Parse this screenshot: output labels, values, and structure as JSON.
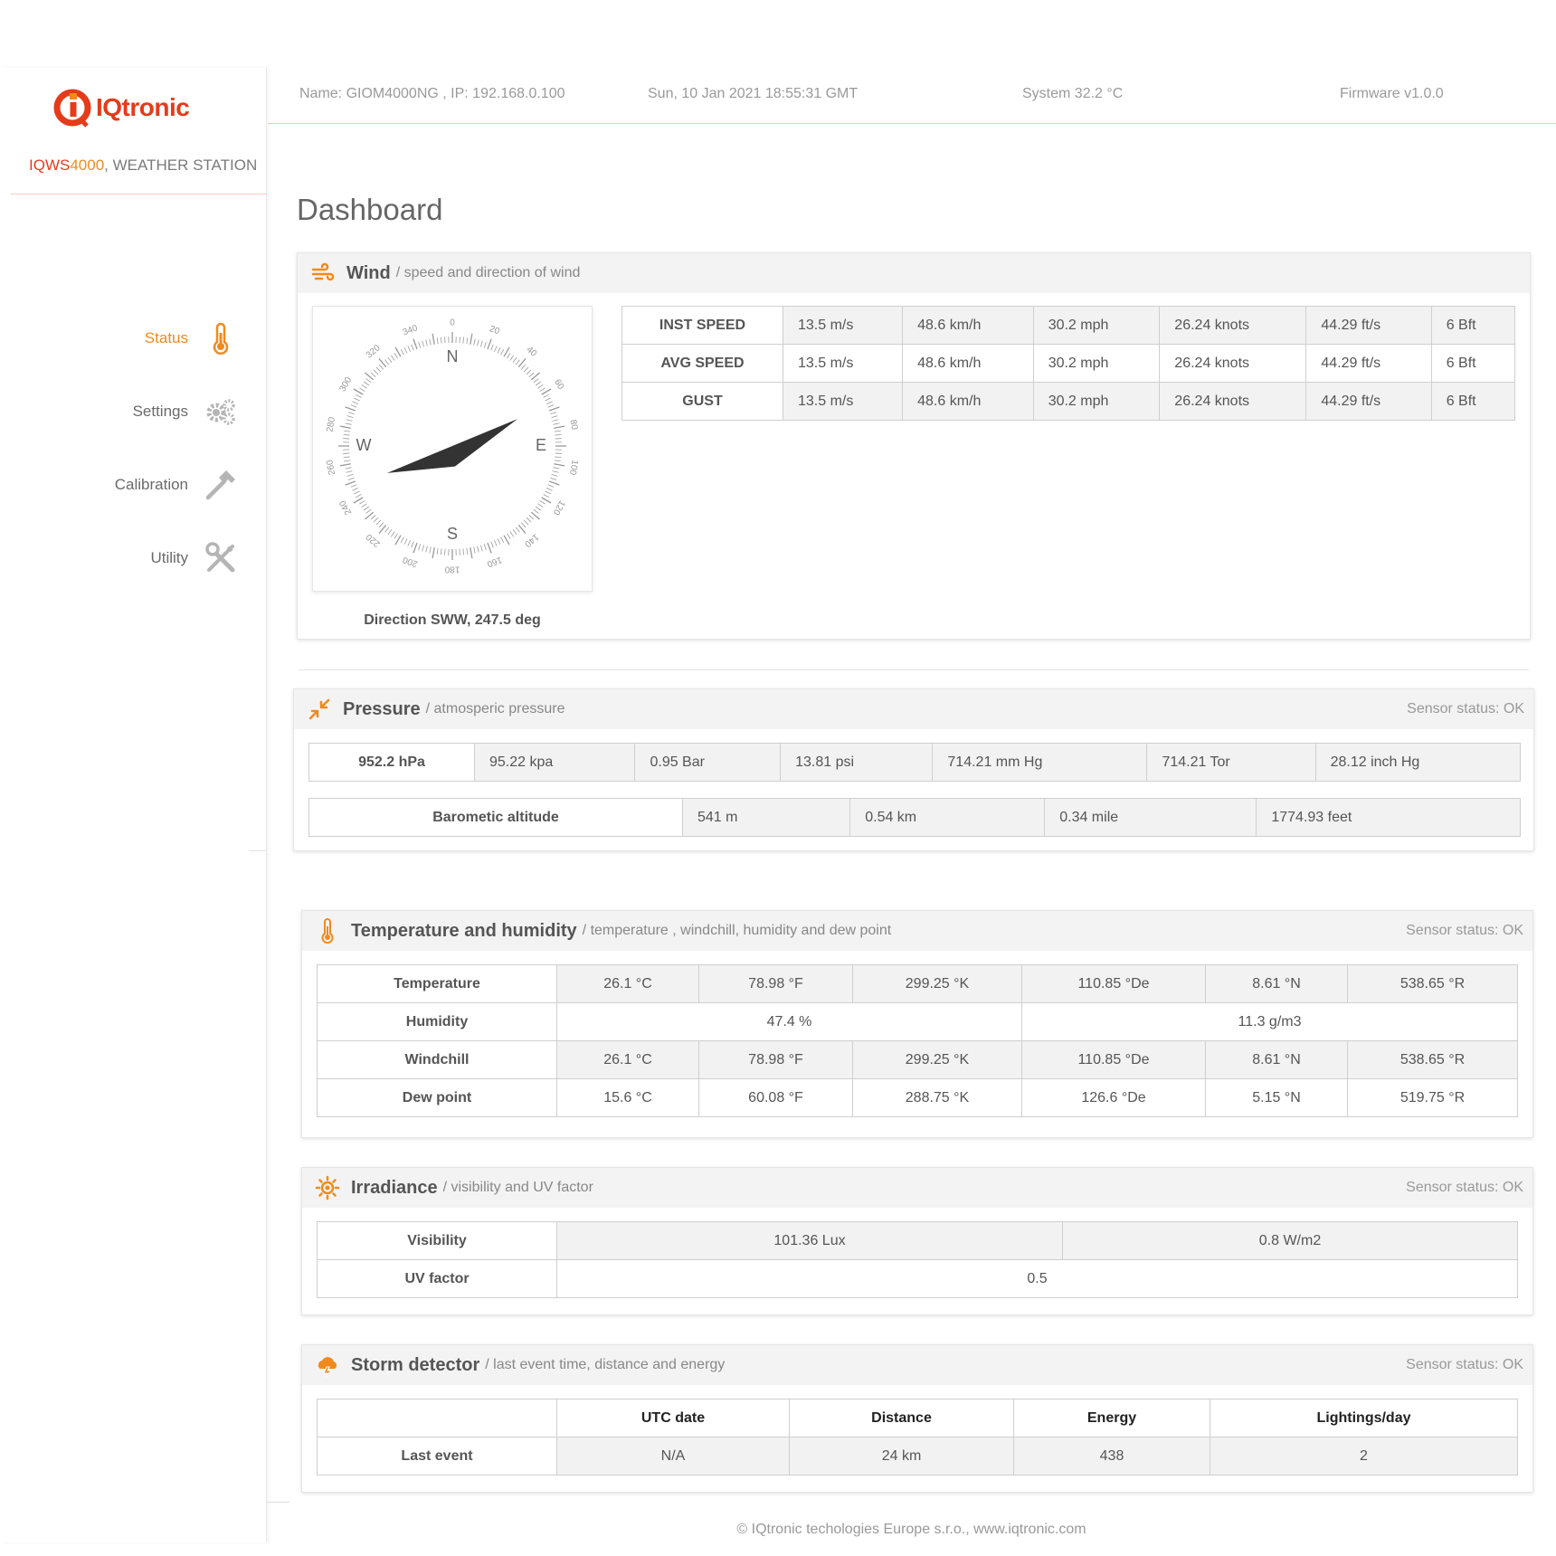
{
  "brand": {
    "logo_text": "IQtronic",
    "model_part1": "IQWS",
    "model_part2": "4000",
    "model_suffix": ", WEATHER STATION"
  },
  "nav": [
    {
      "label": "Status",
      "icon": "thermometer-icon",
      "active": true
    },
    {
      "label": "Settings",
      "icon": "gears-icon",
      "active": false
    },
    {
      "label": "Calibration",
      "icon": "hammer-icon",
      "active": false
    },
    {
      "label": "Utility",
      "icon": "tools-icon",
      "active": false
    }
  ],
  "header": {
    "device": "Name: GIOM4000NG , IP: 192.168.0.100",
    "datetime": "Sun, 10 Jan 2021 18:55:31 GMT",
    "system": "System 32.2 °C",
    "firmware": "Firmware v1.0.0"
  },
  "page_title": "Dashboard",
  "wind": {
    "title": "Wind",
    "subtitle": "/ speed and direction of wind",
    "direction_label": "Direction SWW, 247.5 deg",
    "direction_deg": 247.5,
    "compass": {
      "cardinals": [
        "N",
        "E",
        "S",
        "W"
      ],
      "degrees": [
        "0",
        "20",
        "40",
        "60",
        "80",
        "100",
        "120",
        "140",
        "160",
        "180",
        "200",
        "220",
        "240",
        "260",
        "280",
        "300",
        "320",
        "340"
      ]
    },
    "rows": [
      {
        "label": "INST SPEED",
        "values": [
          "13.5 m/s",
          "48.6 km/h",
          "30.2 mph",
          "26.24 knots",
          "44.29 ft/s",
          "6 Bft"
        ]
      },
      {
        "label": "AVG SPEED",
        "values": [
          "13.5 m/s",
          "48.6 km/h",
          "30.2 mph",
          "26.24 knots",
          "44.29 ft/s",
          "6 Bft"
        ]
      },
      {
        "label": "GUST",
        "values": [
          "13.5 m/s",
          "48.6 km/h",
          "30.2 mph",
          "26.24 knots",
          "44.29 ft/s",
          "6 Bft"
        ]
      }
    ]
  },
  "pressure": {
    "title": "Pressure",
    "subtitle": "/ atmosperic pressure",
    "status": "Sensor status: OK",
    "main": "952.2 hPa",
    "values": [
      "95.22 kpa",
      "0.95 Bar",
      "13.81 psi",
      "714.21 mm Hg",
      "714.21 Tor",
      "28.12 inch Hg"
    ],
    "altitude_label": "Barometic altitude",
    "altitude_values": [
      "541 m",
      "0.54 km",
      "0.34 mile",
      "1774.93 feet"
    ]
  },
  "temperature": {
    "title": "Temperature and humidity",
    "subtitle": "/ temperature , windchill, humidity and dew point",
    "status": "Sensor status: OK",
    "temp_label": "Temperature",
    "temp_values": [
      "26.1 °C",
      "78.98 °F",
      "299.25 °K",
      "110.85 °De",
      "8.61 °N",
      "538.65 °R"
    ],
    "humidity_label": "Humidity",
    "humidity_values": [
      "47.4 %",
      "11.3 g/m3"
    ],
    "windchill_label": "Windchill",
    "windchill_values": [
      "26.1 °C",
      "78.98 °F",
      "299.25 °K",
      "110.85 °De",
      "8.61 °N",
      "538.65 °R"
    ],
    "dew_label": "Dew point",
    "dew_values": [
      "15.6 °C",
      "60.08 °F",
      "288.75 °K",
      "126.6 °De",
      "5.15 °N",
      "519.75 °R"
    ]
  },
  "irradiance": {
    "title": "Irradiance",
    "subtitle": "/ visibility and UV factor",
    "status": "Sensor status: OK",
    "visibility_label": "Visibility",
    "visibility_values": [
      "101.36 Lux",
      "0.8 W/m2"
    ],
    "uv_label": "UV factor",
    "uv_value": "0.5"
  },
  "storm": {
    "title": "Storm detector",
    "subtitle": "/ last event time, distance and energy",
    "status": "Sensor status: OK",
    "headers": [
      "UTC date",
      "Distance",
      "Energy",
      "Lightings/day"
    ],
    "row_label": "Last event",
    "row_values": [
      "N/A",
      "24 km",
      "438",
      "2"
    ]
  },
  "footer": "© IQtronic techologies Europe s.r.o., www.iqtronic.com",
  "colors": {
    "accent": "#f08a1e",
    "brand_red": "#e53b1a"
  }
}
